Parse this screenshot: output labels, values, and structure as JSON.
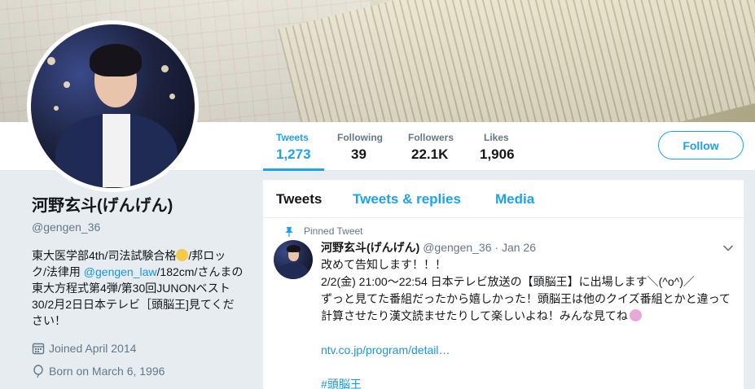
{
  "profile": {
    "name": "河野玄斗(げんげん)",
    "handle": "@gengen_36",
    "bio": {
      "line1_a": "東大医学部4th/司法試験合格",
      "line1_b": "/邦ロッ",
      "line2_a": "ク/法律用 ",
      "line2_mention": "@gengen_law",
      "line2_b": "/182cm/さんまの",
      "line3": "東大方程式第4弾/第30回JUNONベスト",
      "line4": "30/2月2日日本テレビ［頭脳王]見てくだ",
      "line5": "さい！"
    },
    "joined": "Joined April 2014",
    "born": "Born on March 6, 1996"
  },
  "stats": [
    {
      "label": "Tweets",
      "value": "1,273"
    },
    {
      "label": "Following",
      "value": "39"
    },
    {
      "label": "Followers",
      "value": "22.1K"
    },
    {
      "label": "Likes",
      "value": "1,906"
    }
  ],
  "follow_label": "Follow",
  "tabs": [
    {
      "label": "Tweets"
    },
    {
      "label": "Tweets & replies"
    },
    {
      "label": "Media"
    }
  ],
  "tweet": {
    "pinned_label": "Pinned Tweet",
    "author_name": "河野玄斗(げんげん)",
    "author_handle": "@gengen_36",
    "date": "· Jan 26",
    "lines": [
      "改めて告知します！！！",
      "2/2(金) 21:00〜22:54 日本テレビ放送の【頭脳王】に出場します＼(^o^)／",
      "ずっと見てた番組だったから嬉しかった！頭脳王は他のクイズ番組とかと違って",
      "計算させたり漢文読ませたりして楽しいよね！みんな見てね"
    ],
    "link": "ntv.co.jp/program/detail…",
    "hashtag": "#頭脳王"
  },
  "icons": {
    "calendar": "calendar-icon",
    "balloon": "balloon-icon",
    "pin": "pin-icon",
    "caret": "chevron-down-icon"
  },
  "colors": {
    "accent": "#1da1f2",
    "link": "#1b95e0",
    "muted": "#657786",
    "background": "#e6ecf0"
  }
}
